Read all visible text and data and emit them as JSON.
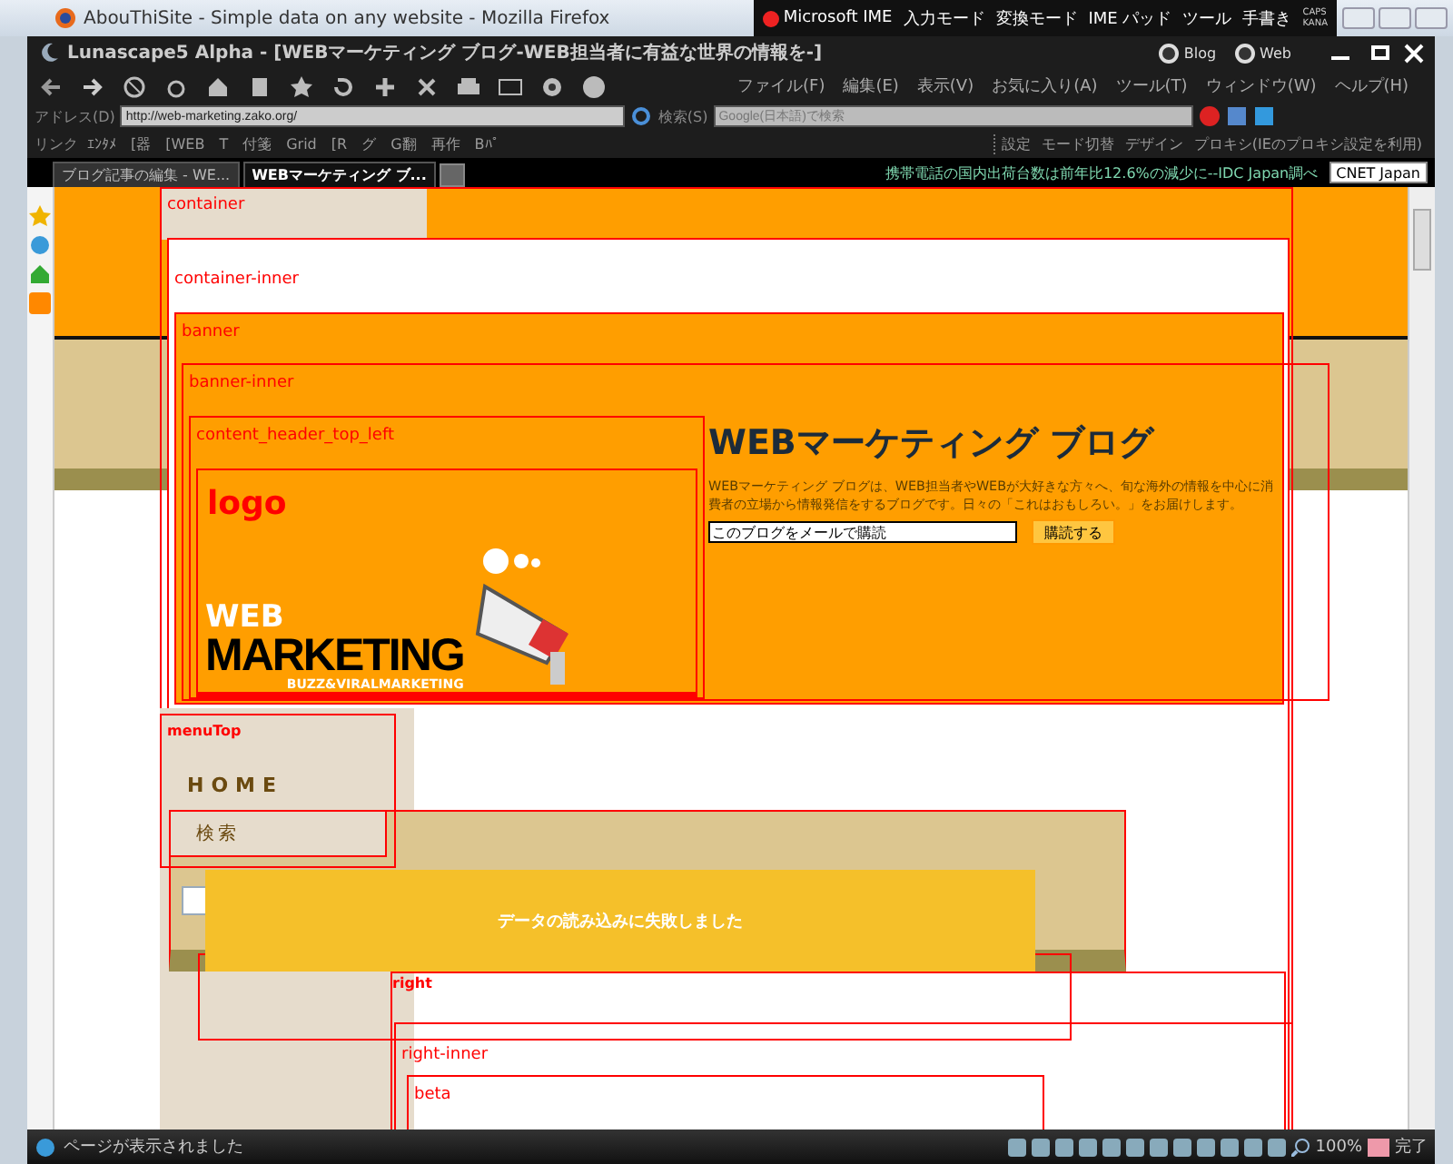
{
  "background_window": {
    "title": "AbouThiSite - Simple data on any website - Mozilla Firefox"
  },
  "ime_bar": {
    "items": [
      "Microsoft IME",
      "入力モード",
      "変換モード",
      "IME パッド",
      "ツール",
      "手書き"
    ],
    "indicators": [
      "CAPS",
      "KANA"
    ]
  },
  "window": {
    "title": "Lunascape5 Alpha - [WEBマーケティング ブログ-WEB担当者に有益な世界の情報を-]",
    "modes": [
      {
        "label": "Blog",
        "selected": false
      },
      {
        "label": "Web",
        "selected": false
      }
    ]
  },
  "menu": [
    "ファイル(F)",
    "編集(E)",
    "表示(V)",
    "お気に入り(A)",
    "ツール(T)",
    "ウィンドウ(W)",
    "ヘルプ(H)"
  ],
  "address": {
    "label": "アドレス(D)",
    "value": "http://web-marketing.zako.org/"
  },
  "search": {
    "label": "検索(S)",
    "placeholder": "Google(日本語)で検索"
  },
  "links": {
    "label": "リンク",
    "items": [
      "ｴﾝﾀﾒ",
      "[器",
      "[WEB",
      "T",
      "付箋",
      "Grid",
      "[R",
      "グ",
      "G翻",
      "再作",
      "Bﾊﾟ"
    ]
  },
  "toolbar_2": [
    "設定",
    "モード切替",
    "デザイン",
    "プロキシ(IEのプロキシ設定を利用)"
  ],
  "tabs": [
    {
      "label": "ブログ記事の編集 - WE...",
      "selected": false
    },
    {
      "label": "WEBマーケティング ブ...",
      "selected": true
    }
  ],
  "news": {
    "headline": "携帯電話の国内出荷台数は前年比12.6%の減少に--IDC Japan調べ",
    "source": "CNET Japan"
  },
  "page": {
    "outline_labels": [
      "container",
      "container-inner",
      "banner",
      "banner-inner",
      "content_header_top_left",
      "menuTop",
      "right",
      "right-inner",
      "beta"
    ],
    "logo_label": "logo",
    "logo_art": {
      "line_1": "WEB",
      "line_2": "MARKETING",
      "tagline": "BUZZ&VIRALMARKETING"
    },
    "blog_title": "WEBマーケティング ブログ",
    "description": "WEBマーケティング ブログは、WEB担当者やWEBが大好きな方々へ、旬な海外の情報を中心に消費者の立場から情報発信をするブログです。日々の「これはおもしろい。」をお届けします。",
    "subscribe": {
      "value": "このブログをメールで購読",
      "button": "購読する"
    },
    "menu_items": [
      "HOME",
      "検索"
    ],
    "error_toast": "データの読み込みに失敗しました"
  },
  "status_bar": {
    "text": "ページが表示されました",
    "zoom": "100%",
    "state": "完了"
  }
}
